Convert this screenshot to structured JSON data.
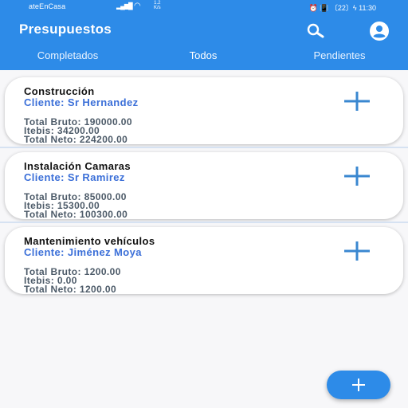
{
  "status_bar": {
    "carrier": "ateEnCasa",
    "speed_top": "1.2",
    "speed_bottom": "K/s",
    "right": "⏰ 📳 〔22〕ϟ 11:30"
  },
  "app": {
    "title": "Presupuestos",
    "accent_color": "#2d8be8"
  },
  "tabs": [
    {
      "label": "Completados",
      "selected": false
    },
    {
      "label": "Todos",
      "selected": true
    },
    {
      "label": "Pendientes",
      "selected": false
    }
  ],
  "budgets": [
    {
      "name": "Construcción",
      "client": "Cliente: Sr Hernandez",
      "bruto": "Total Bruto: 190000.00",
      "itebis": "Itebis:  34200.00",
      "neto": "Total Neto: 224200.00"
    },
    {
      "name": "Instalación Camaras",
      "client": "Cliente: Sr Ramirez",
      "bruto": "Total Bruto: 85000.00",
      "itebis": "Itebis:  15300.00",
      "neto": "Total Neto: 100300.00"
    },
    {
      "name": "Mantenimiento vehículos",
      "client": "Cliente: Jiménez Moya",
      "bruto": "Total Bruto: 1200.00",
      "itebis": "Itebis:  0.00",
      "neto": "Total Neto: 1200.00"
    }
  ],
  "icons": {
    "search": "search-icon",
    "account": "account-icon",
    "add": "plus-icon",
    "fab": "plus-icon"
  }
}
